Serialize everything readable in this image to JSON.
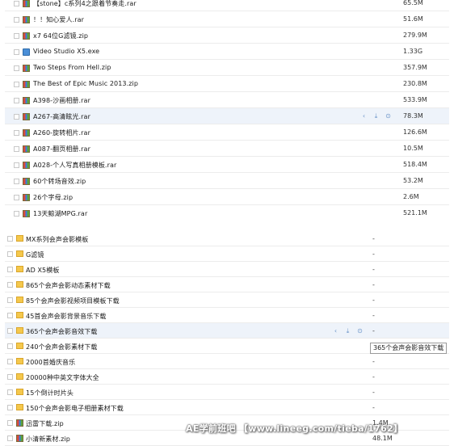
{
  "panel_a": {
    "rows": [
      {
        "name": "【stone】c系列4之跟着节奏走.rar",
        "size": "65.5M",
        "icon": "archive-icon"
      },
      {
        "name": "！！知心爱人.rar",
        "size": "51.6M",
        "icon": "archive-icon"
      },
      {
        "name": "x7 64位G滤镜.zip",
        "size": "279.9M",
        "icon": "archive-icon"
      },
      {
        "name": "Video Studio X5.exe",
        "size": "1.33G",
        "icon": "exe-icon"
      },
      {
        "name": "Two Steps From Hell.zip",
        "size": "357.9M",
        "icon": "archive-icon"
      },
      {
        "name": "The Best of Epic Music 2013.zip",
        "size": "230.8M",
        "icon": "archive-icon"
      },
      {
        "name": "A398-沙画相册.rar",
        "size": "533.9M",
        "icon": "archive-icon"
      },
      {
        "name": "A267-高清眩光.rar",
        "size": "78.3M",
        "icon": "archive-icon",
        "highlighted": true
      },
      {
        "name": "A260-旋转相片.rar",
        "size": "126.6M",
        "icon": "archive-icon"
      },
      {
        "name": "A087-翻页相册.rar",
        "size": "10.5M",
        "icon": "archive-icon"
      },
      {
        "name": "A028-个人写真相册模板.rar",
        "size": "518.4M",
        "icon": "archive-icon"
      },
      {
        "name": "60个转场音效.zip",
        "size": "53.2M",
        "icon": "archive-icon"
      },
      {
        "name": "26个字母.zip",
        "size": "2.6M",
        "icon": "archive-icon"
      },
      {
        "name": "13天鲸湖MPG.rar",
        "size": "521.1M",
        "icon": "archive-icon"
      }
    ]
  },
  "panel_b": {
    "rows": [
      {
        "name": "MX系列会声会影模板",
        "size": "-",
        "icon": "folder-icon"
      },
      {
        "name": "G滤镜",
        "size": "-",
        "icon": "folder-icon"
      },
      {
        "name": "AD X5模板",
        "size": "-",
        "icon": "folder-icon"
      },
      {
        "name": "865个会声会影动态素材下载",
        "size": "-",
        "icon": "folder-icon"
      },
      {
        "name": "85个会声会影视频项目模板下载",
        "size": "-",
        "icon": "folder-icon"
      },
      {
        "name": "45首会声会影背景音乐下载",
        "size": "-",
        "icon": "folder-icon"
      },
      {
        "name": "365个会声会影音效下载",
        "size": "-",
        "icon": "folder-icon",
        "highlighted": true
      },
      {
        "name": "240个会声会影素材下载",
        "size": "-",
        "icon": "folder-icon"
      },
      {
        "name": "2000首婚庆音乐",
        "size": "-",
        "icon": "folder-icon"
      },
      {
        "name": "20000种中英文字体大全",
        "size": "-",
        "icon": "folder-icon"
      },
      {
        "name": "15个倒计时片头",
        "size": "-",
        "icon": "folder-icon"
      },
      {
        "name": "150个会声会影电子相册素材下载",
        "size": "-",
        "icon": "folder-icon"
      },
      {
        "name": "迅雷下载.zip",
        "size": "1.4M",
        "icon": "archive-icon"
      },
      {
        "name": "小清新素材.zip",
        "size": "48.1M",
        "icon": "archive-icon"
      }
    ]
  },
  "actions": {
    "share": "share-icon",
    "download": "download-icon",
    "more": "more-icon"
  },
  "tooltip": "365个会声会影音效下载",
  "watermark": "AE学前班吧 【www.lineeg.com/tieba/1762】",
  "colors": {
    "highlight_row": "#eef3fa",
    "action_icon": "#6b94c8",
    "folder": "#f5c84c"
  }
}
